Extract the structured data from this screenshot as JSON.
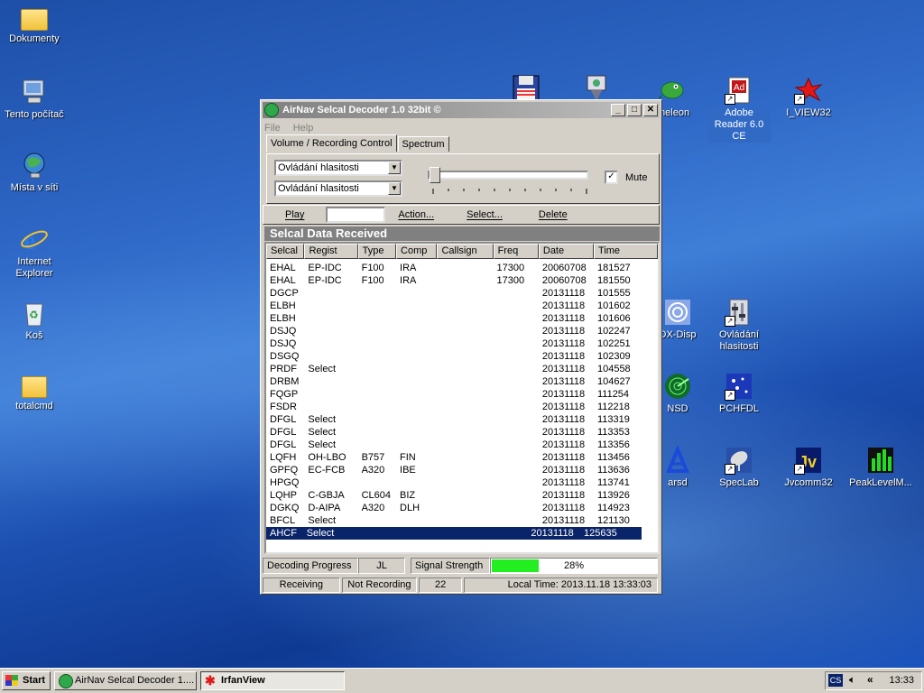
{
  "desktop": {
    "icons": [
      {
        "label": "Dokumenty"
      },
      {
        "label": "Tento počítač"
      },
      {
        "label": "Místa v síti"
      },
      {
        "label": "Internet Explorer"
      },
      {
        "label": "Koš"
      },
      {
        "label": "totalcmd"
      },
      {
        "label": "ameleon"
      },
      {
        "label": "Adobe Reader 6.0 CE"
      },
      {
        "label": "I_VIEW32"
      },
      {
        "label": "DX-Disp"
      },
      {
        "label": "Ovládání hlasitosti"
      },
      {
        "label": "NSD"
      },
      {
        "label": "PCHFDL"
      },
      {
        "label": "arsd"
      },
      {
        "label": "SpecLab"
      },
      {
        "label": "Jvcomm32"
      },
      {
        "label": "PeakLevelM..."
      }
    ]
  },
  "window": {
    "title": "AirNav Selcal Decoder 1.0 32bit ©",
    "menu": [
      "File",
      "Help"
    ],
    "tabs": [
      "Volume / Recording Control",
      "Spectrum"
    ],
    "combo1": "Ovládání hlasitosti",
    "combo2": "Ovládání hlasitosti",
    "mute_label": "Mute",
    "mute_checked": true,
    "toolbar": {
      "play": "Play",
      "action": "Action...",
      "select": "Select...",
      "delete": "Delete"
    },
    "section_title": "Selcal Data Received",
    "columns": [
      "Selcal",
      "Regist",
      "Type",
      "Comp",
      "Callsign",
      "Freq",
      "Date",
      "Time"
    ],
    "rows": [
      [
        "EHAL",
        "EP-IDC",
        "F100",
        "IRA",
        "",
        "17300",
        "20060708",
        "181527"
      ],
      [
        "EHAL",
        "EP-IDC",
        "F100",
        "IRA",
        "",
        "17300",
        "20060708",
        "181550"
      ],
      [
        "DGCP",
        "",
        "",
        "",
        "",
        "",
        "20131118",
        "101555"
      ],
      [
        "ELBH",
        "",
        "",
        "",
        "",
        "",
        "20131118",
        "101602"
      ],
      [
        "ELBH",
        "",
        "",
        "",
        "",
        "",
        "20131118",
        "101606"
      ],
      [
        "DSJQ",
        "",
        "",
        "",
        "",
        "",
        "20131118",
        "102247"
      ],
      [
        "DSJQ",
        "",
        "",
        "",
        "",
        "",
        "20131118",
        "102251"
      ],
      [
        "DSGQ",
        "",
        "",
        "",
        "",
        "",
        "20131118",
        "102309"
      ],
      [
        "PRDF",
        "Select",
        "",
        "",
        "",
        "",
        "20131118",
        "104558"
      ],
      [
        "DRBM",
        "",
        "",
        "",
        "",
        "",
        "20131118",
        "104627"
      ],
      [
        "FQGP",
        "",
        "",
        "",
        "",
        "",
        "20131118",
        "111254"
      ],
      [
        "FSDR",
        "",
        "",
        "",
        "",
        "",
        "20131118",
        "112218"
      ],
      [
        "DFGL",
        "Select",
        "",
        "",
        "",
        "",
        "20131118",
        "113319"
      ],
      [
        "DFGL",
        "Select",
        "",
        "",
        "",
        "",
        "20131118",
        "113353"
      ],
      [
        "DFGL",
        "Select",
        "",
        "",
        "",
        "",
        "20131118",
        "113356"
      ],
      [
        "LQFH",
        "OH-LBO",
        "B757",
        "FIN",
        "",
        "",
        "20131118",
        "113456"
      ],
      [
        "GPFQ",
        "EC-FCB",
        "A320",
        "IBE",
        "",
        "",
        "20131118",
        "113636"
      ],
      [
        "HPGQ",
        "",
        "",
        "",
        "",
        "",
        "20131118",
        "113741"
      ],
      [
        "LQHP",
        "C-GBJA",
        "CL604",
        "BIZ",
        "",
        "",
        "20131118",
        "113926"
      ],
      [
        "DGKQ",
        "D-AIPA",
        "A320",
        "DLH",
        "",
        "",
        "20131118",
        "114923"
      ],
      [
        "BFCL",
        "Select",
        "",
        "",
        "",
        "",
        "20131118",
        "121130"
      ],
      [
        "AHCF",
        "Select",
        "",
        "",
        "",
        "",
        "20131118",
        "125635"
      ]
    ],
    "selected_row": 21,
    "decoding_progress_label": "Decoding Progress",
    "decoding_value": "JL",
    "signal_label": "Signal Strength",
    "signal_pct": "28%",
    "signal_fraction": 0.28,
    "status": {
      "receiving": "Receiving",
      "recording": "Not Recording",
      "count": "22",
      "local_time": "Local Time: 2013.11.18 13:33:03"
    }
  },
  "taskbar": {
    "start": "Start",
    "buttons": [
      "AirNav Selcal Decoder 1....",
      "IrfanView"
    ],
    "lang": "CS",
    "clock": "13:33"
  },
  "colors": {
    "signal_fill": "#22ee22",
    "selection": "#0a246a"
  }
}
